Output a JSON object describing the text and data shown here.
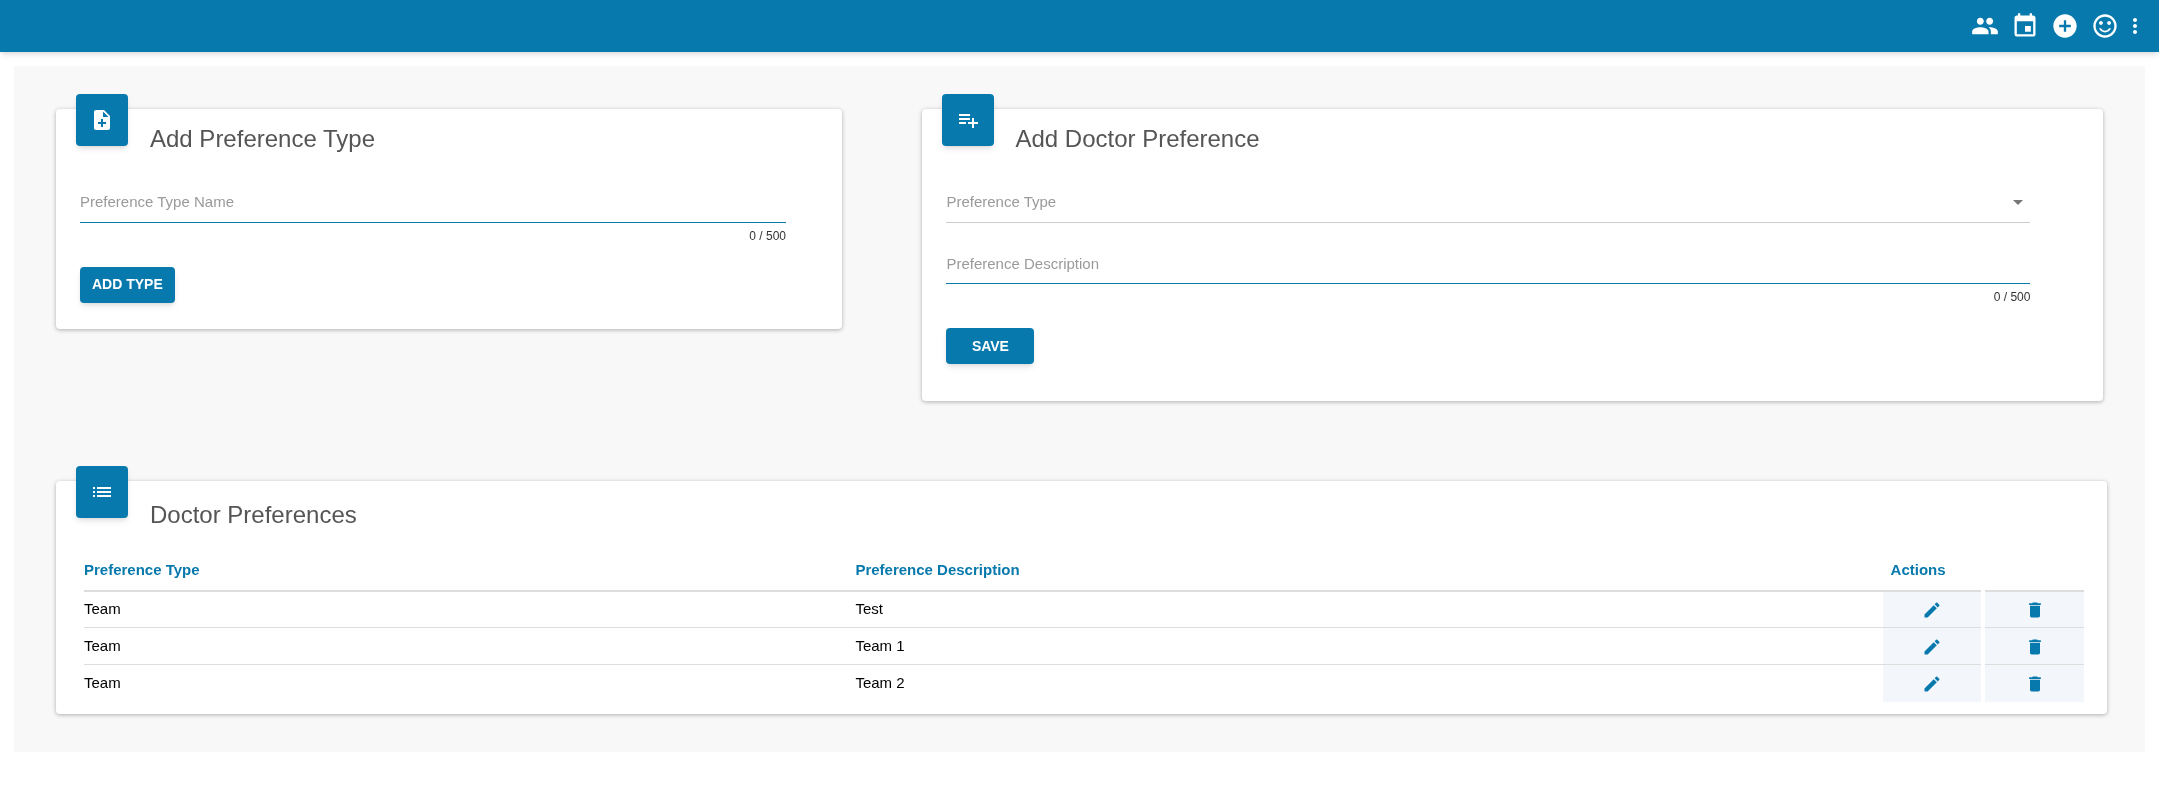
{
  "type_card": {
    "title": "Add Preference Type",
    "field": {
      "placeholder": "Preference Type Name",
      "counter": "0 / 500"
    },
    "button": "ADD TYPE"
  },
  "doctor_card": {
    "title": "Add Doctor Preference",
    "select": {
      "placeholder": "Preference Type"
    },
    "field": {
      "placeholder": "Preference Description",
      "counter": "0 / 500"
    },
    "button": "SAVE"
  },
  "table": {
    "title": "Doctor Preferences",
    "columns": [
      "Preference Type",
      "Preference Description",
      "Actions"
    ],
    "rows": [
      {
        "type": "Team",
        "description": "Test"
      },
      {
        "type": "Team",
        "description": "Team 1"
      },
      {
        "type": "Team",
        "description": "Team 2"
      }
    ]
  }
}
